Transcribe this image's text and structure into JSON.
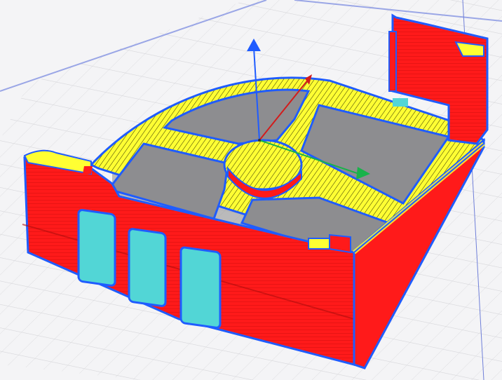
{
  "viewport": {
    "name": "slicer-layer-preview",
    "background": "#f4f4f6"
  },
  "colors": {
    "grid_minor": "#d3d3d7",
    "grid_major": "#c2c2c6",
    "plate_edge": "#6f7fd8",
    "wall_outer": "#ff1a1a",
    "wall_inner": "#1f5cff",
    "infill": "#ffff33",
    "infill_line": "#2b2b00",
    "support_cyan": "#52d6d6",
    "floor_shadow": "#8a8a8a",
    "axis_x": "#18b34a",
    "axis_y": "#d31b1b",
    "axis_z": "#1f5cff"
  },
  "gizmo": {
    "axes": [
      "x-axis",
      "y-axis",
      "z-axis"
    ]
  }
}
